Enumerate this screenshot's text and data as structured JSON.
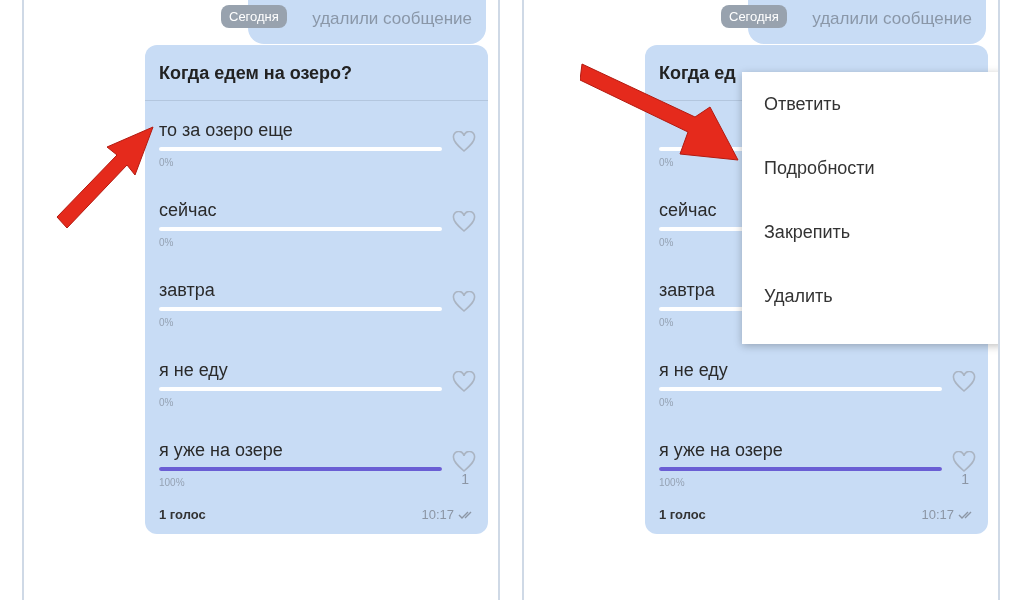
{
  "panels": [
    {
      "date_chip": "Сегодня",
      "previous_message": "удалили сообщение",
      "arrow": {
        "kind": "up-right"
      },
      "poll": {
        "question": "Когда едем на озеро?",
        "options": [
          {
            "text": "то за озеро еще",
            "percent": "0%",
            "heart": true
          },
          {
            "text": "сейчас",
            "percent": "0%",
            "heart": true
          },
          {
            "text": "завтра",
            "percent": "0%",
            "heart": true
          },
          {
            "text": "я не еду",
            "percent": "0%",
            "heart": true
          },
          {
            "text": "я уже на озере",
            "percent": "100%",
            "level": 1,
            "heart": true,
            "votes": "1"
          }
        ],
        "votes_label": "1 голос",
        "time": "10:17",
        "read": true
      }
    },
    {
      "date_chip": "Сегодня",
      "previous_message": "удалили сообщение",
      "arrow": {
        "kind": "down-right"
      },
      "poll": {
        "question": "Когда ед",
        "options": [
          {
            "percent": "0%",
            "heart": false
          },
          {
            "text": "сейчас",
            "percent": "0%",
            "heart": false
          },
          {
            "text": "завтра",
            "percent": "0%",
            "heart": false
          },
          {
            "text": "я не еду",
            "percent": "0%",
            "heart": true
          },
          {
            "text": "я уже на озере",
            "percent": "100%",
            "level": 1,
            "heart": true,
            "votes": "1"
          }
        ],
        "votes_label": "1 голос",
        "time": "10:17",
        "read": true
      },
      "menu": [
        "Ответить",
        "Подробности",
        "Закрепить",
        "Удалить"
      ]
    }
  ]
}
